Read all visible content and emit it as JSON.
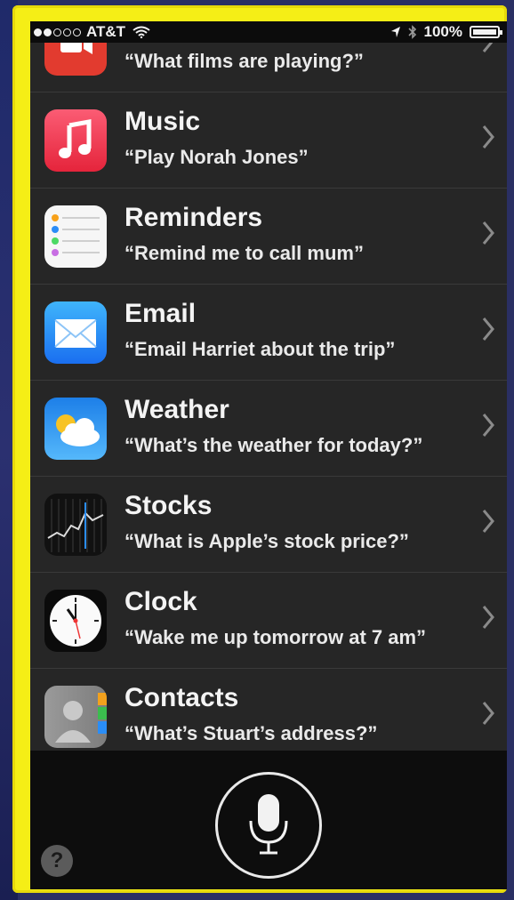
{
  "status_bar": {
    "carrier": "AT&T",
    "battery": "100%",
    "signal_bars_filled": 2,
    "signal_bars_total": 5
  },
  "suggestions": [
    {
      "app": "",
      "phrase": "“What films are playing?”",
      "icon": "video-camera-icon",
      "color": "#e23b2f"
    },
    {
      "app": "Music",
      "phrase": "“Play Norah Jones”",
      "icon": "music-note-icon",
      "color": "#f2374f"
    },
    {
      "app": "Reminders",
      "phrase": "“Remind me to call mum”",
      "icon": "reminders-list-icon",
      "color": "#f6f6f6"
    },
    {
      "app": "Email",
      "phrase": "“Email Harriet about the trip”",
      "icon": "envelope-icon",
      "color": "#2a8df6"
    },
    {
      "app": "Weather",
      "phrase": "“What’s the weather for today?”",
      "icon": "weather-sun-cloud-icon",
      "color": "#2c8ff2"
    },
    {
      "app": "Stocks",
      "phrase": "“What is Apple’s stock price?”",
      "icon": "stocks-chart-icon",
      "color": "#111111"
    },
    {
      "app": "Clock",
      "phrase": "“Wake me up tomorrow at 7 am”",
      "icon": "clock-icon",
      "color": "#0b0b0b"
    },
    {
      "app": "Contacts",
      "phrase": "“What’s Stuart’s address?”",
      "icon": "contacts-icon",
      "color": "#8c8c8c"
    }
  ],
  "controls": {
    "mic_icon": "microphone-icon",
    "help_label": "?"
  }
}
